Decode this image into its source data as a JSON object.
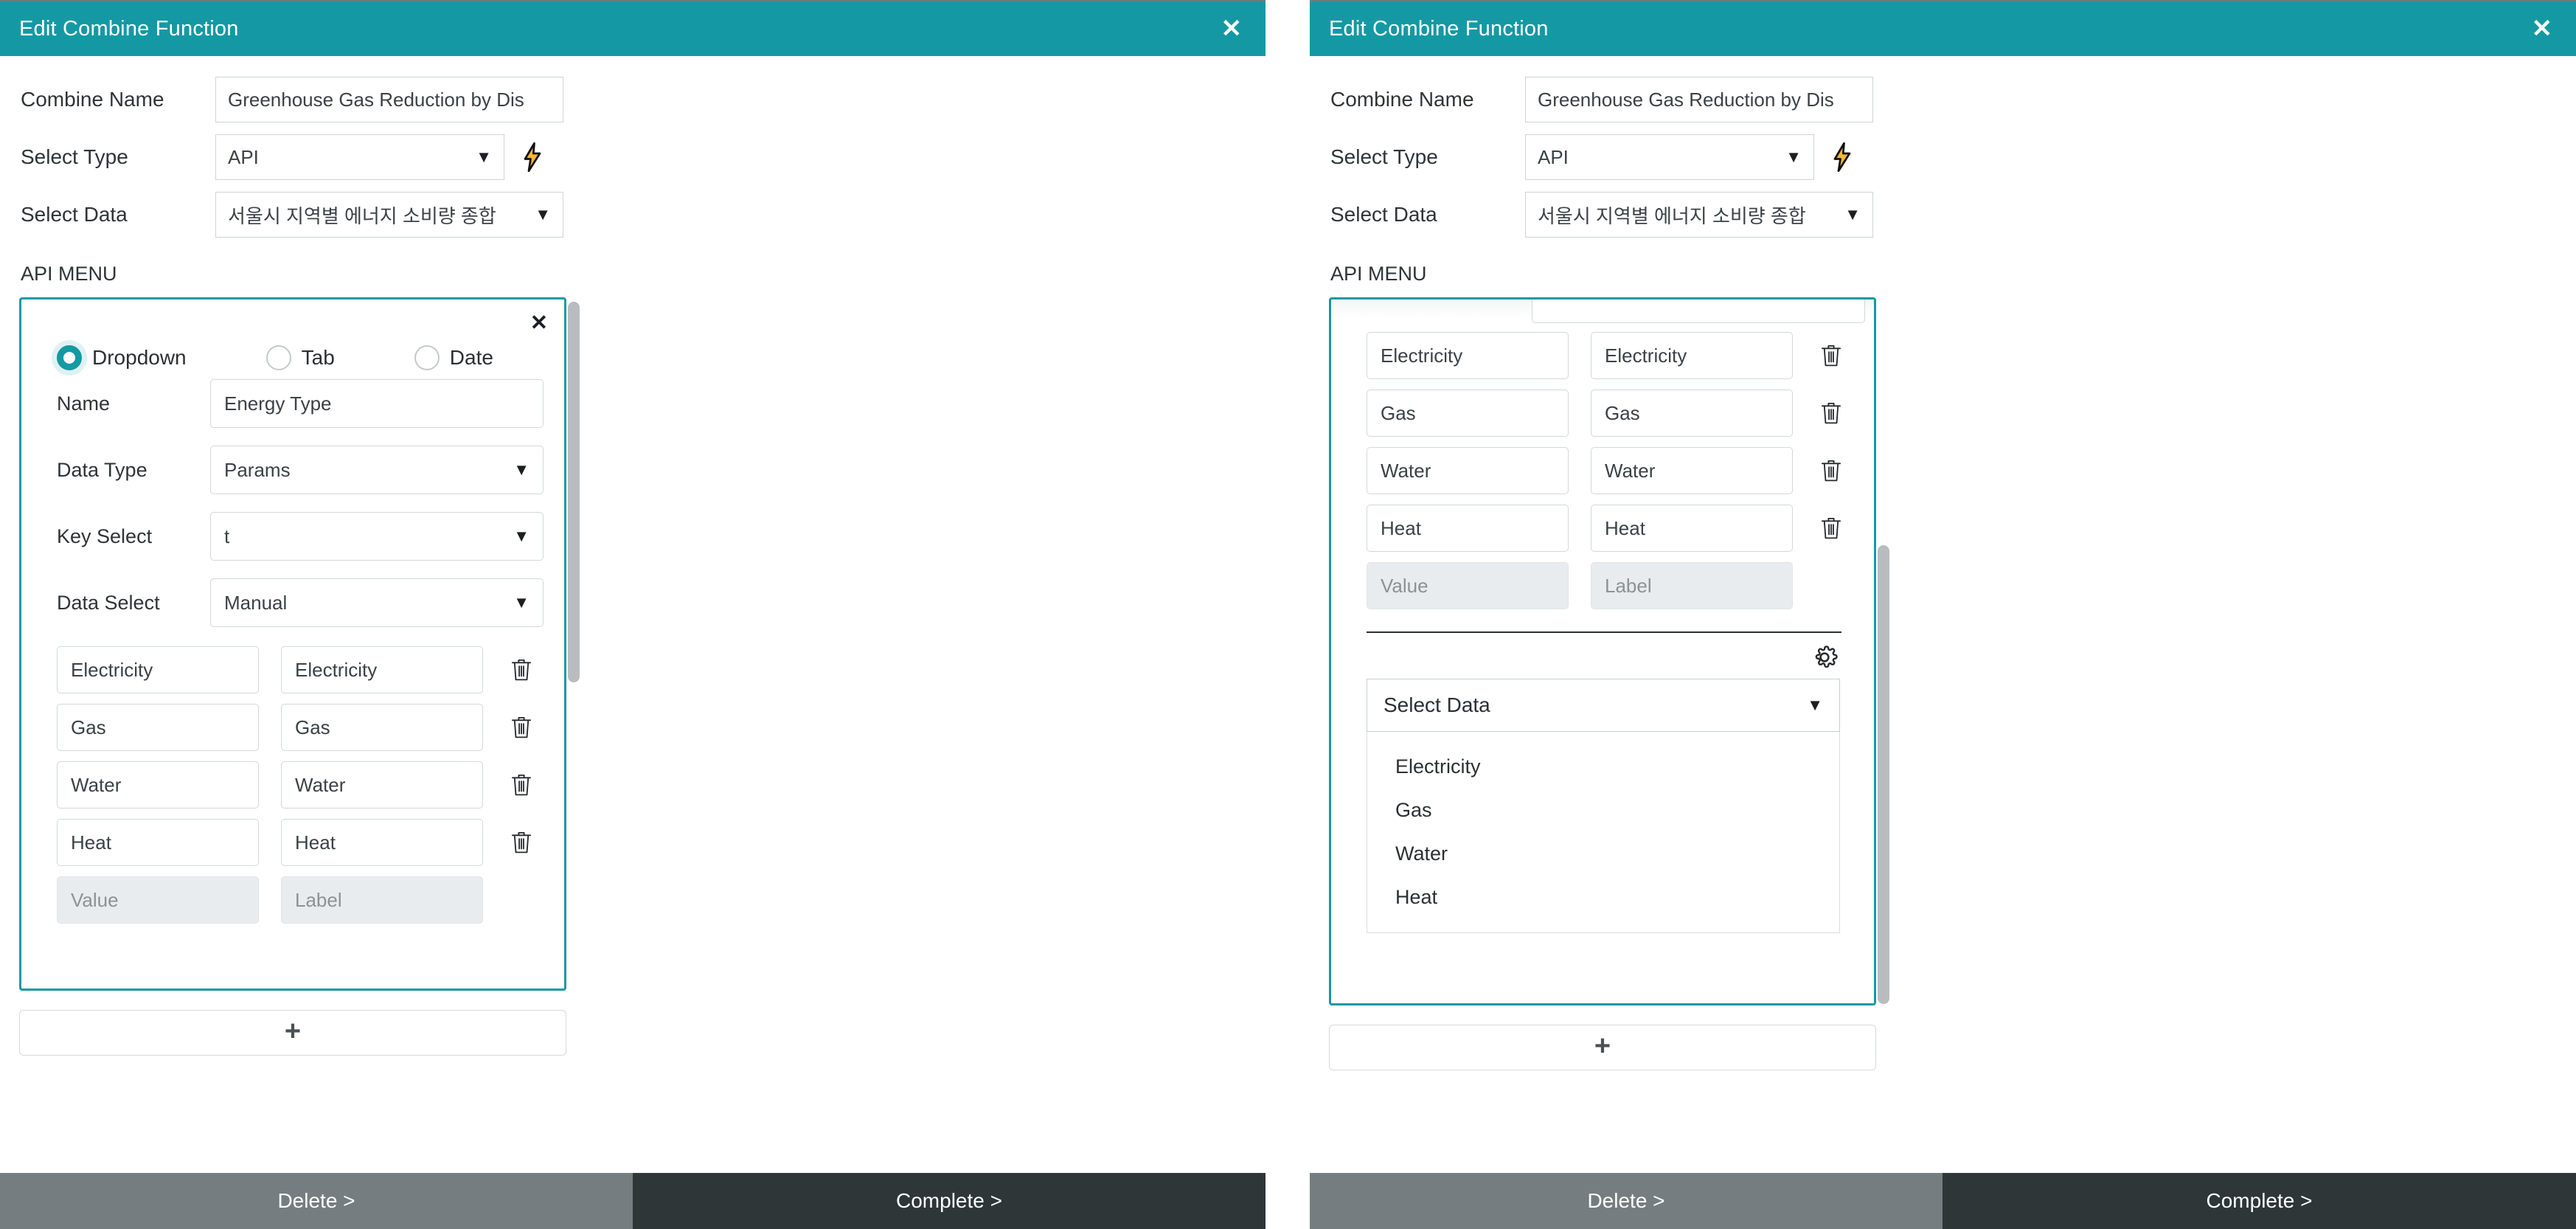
{
  "window": {
    "title": "Edit Combine Function",
    "close_icon": "close-icon"
  },
  "form": {
    "combine_name": {
      "label": "Combine Name",
      "value": "Greenhouse Gas Reduction by Dis"
    },
    "select_type": {
      "label": "Select Type",
      "value": "API",
      "caret": "▼",
      "action_icon": "lightning-bolt-icon"
    },
    "select_data": {
      "label": "Select Data",
      "value": "서울시 지역별 에너지 소비량 종합",
      "caret": "▼"
    }
  },
  "api_menu": {
    "title": "API MENU",
    "card_close_icon": "close-icon",
    "menu_types": [
      {
        "label": "Dropdown",
        "checked": true
      },
      {
        "label": "Tab",
        "checked": false
      },
      {
        "label": "Date",
        "checked": false
      }
    ],
    "fields": {
      "name": {
        "label": "Name",
        "value": "Energy Type"
      },
      "data_type": {
        "label": "Data Type",
        "value": "Params",
        "caret": "▼"
      },
      "key_select": {
        "label": "Key Select",
        "value": "t",
        "caret": "▼"
      },
      "data_select": {
        "label": "Data Select",
        "value": "Manual",
        "caret": "▼"
      }
    },
    "pairs_header": {
      "value_placeholder": "Value",
      "label_placeholder": "Label"
    },
    "pairs": [
      {
        "value": "Electricity",
        "label": "Electricity"
      },
      {
        "value": "Gas",
        "label": "Gas"
      },
      {
        "value": "Water",
        "label": "Water"
      },
      {
        "value": "Heat",
        "label": "Heat"
      }
    ],
    "trash_icon": "trash-icon",
    "gear_icon": "gear-icon",
    "select_data_preview": {
      "placeholder": "Select Data",
      "caret": "▼",
      "options": [
        "Electricity",
        "Gas",
        "Water",
        "Heat"
      ]
    },
    "add_button": {
      "icon": "plus-icon",
      "label": "+"
    }
  },
  "footer": {
    "delete_label": "Delete >",
    "complete_label": "Complete >"
  },
  "colors": {
    "accent_teal": "#1499a4",
    "footer_delete": "#767d80",
    "footer_complete": "#2e3638",
    "bolt_yellow": "#f5a623"
  }
}
